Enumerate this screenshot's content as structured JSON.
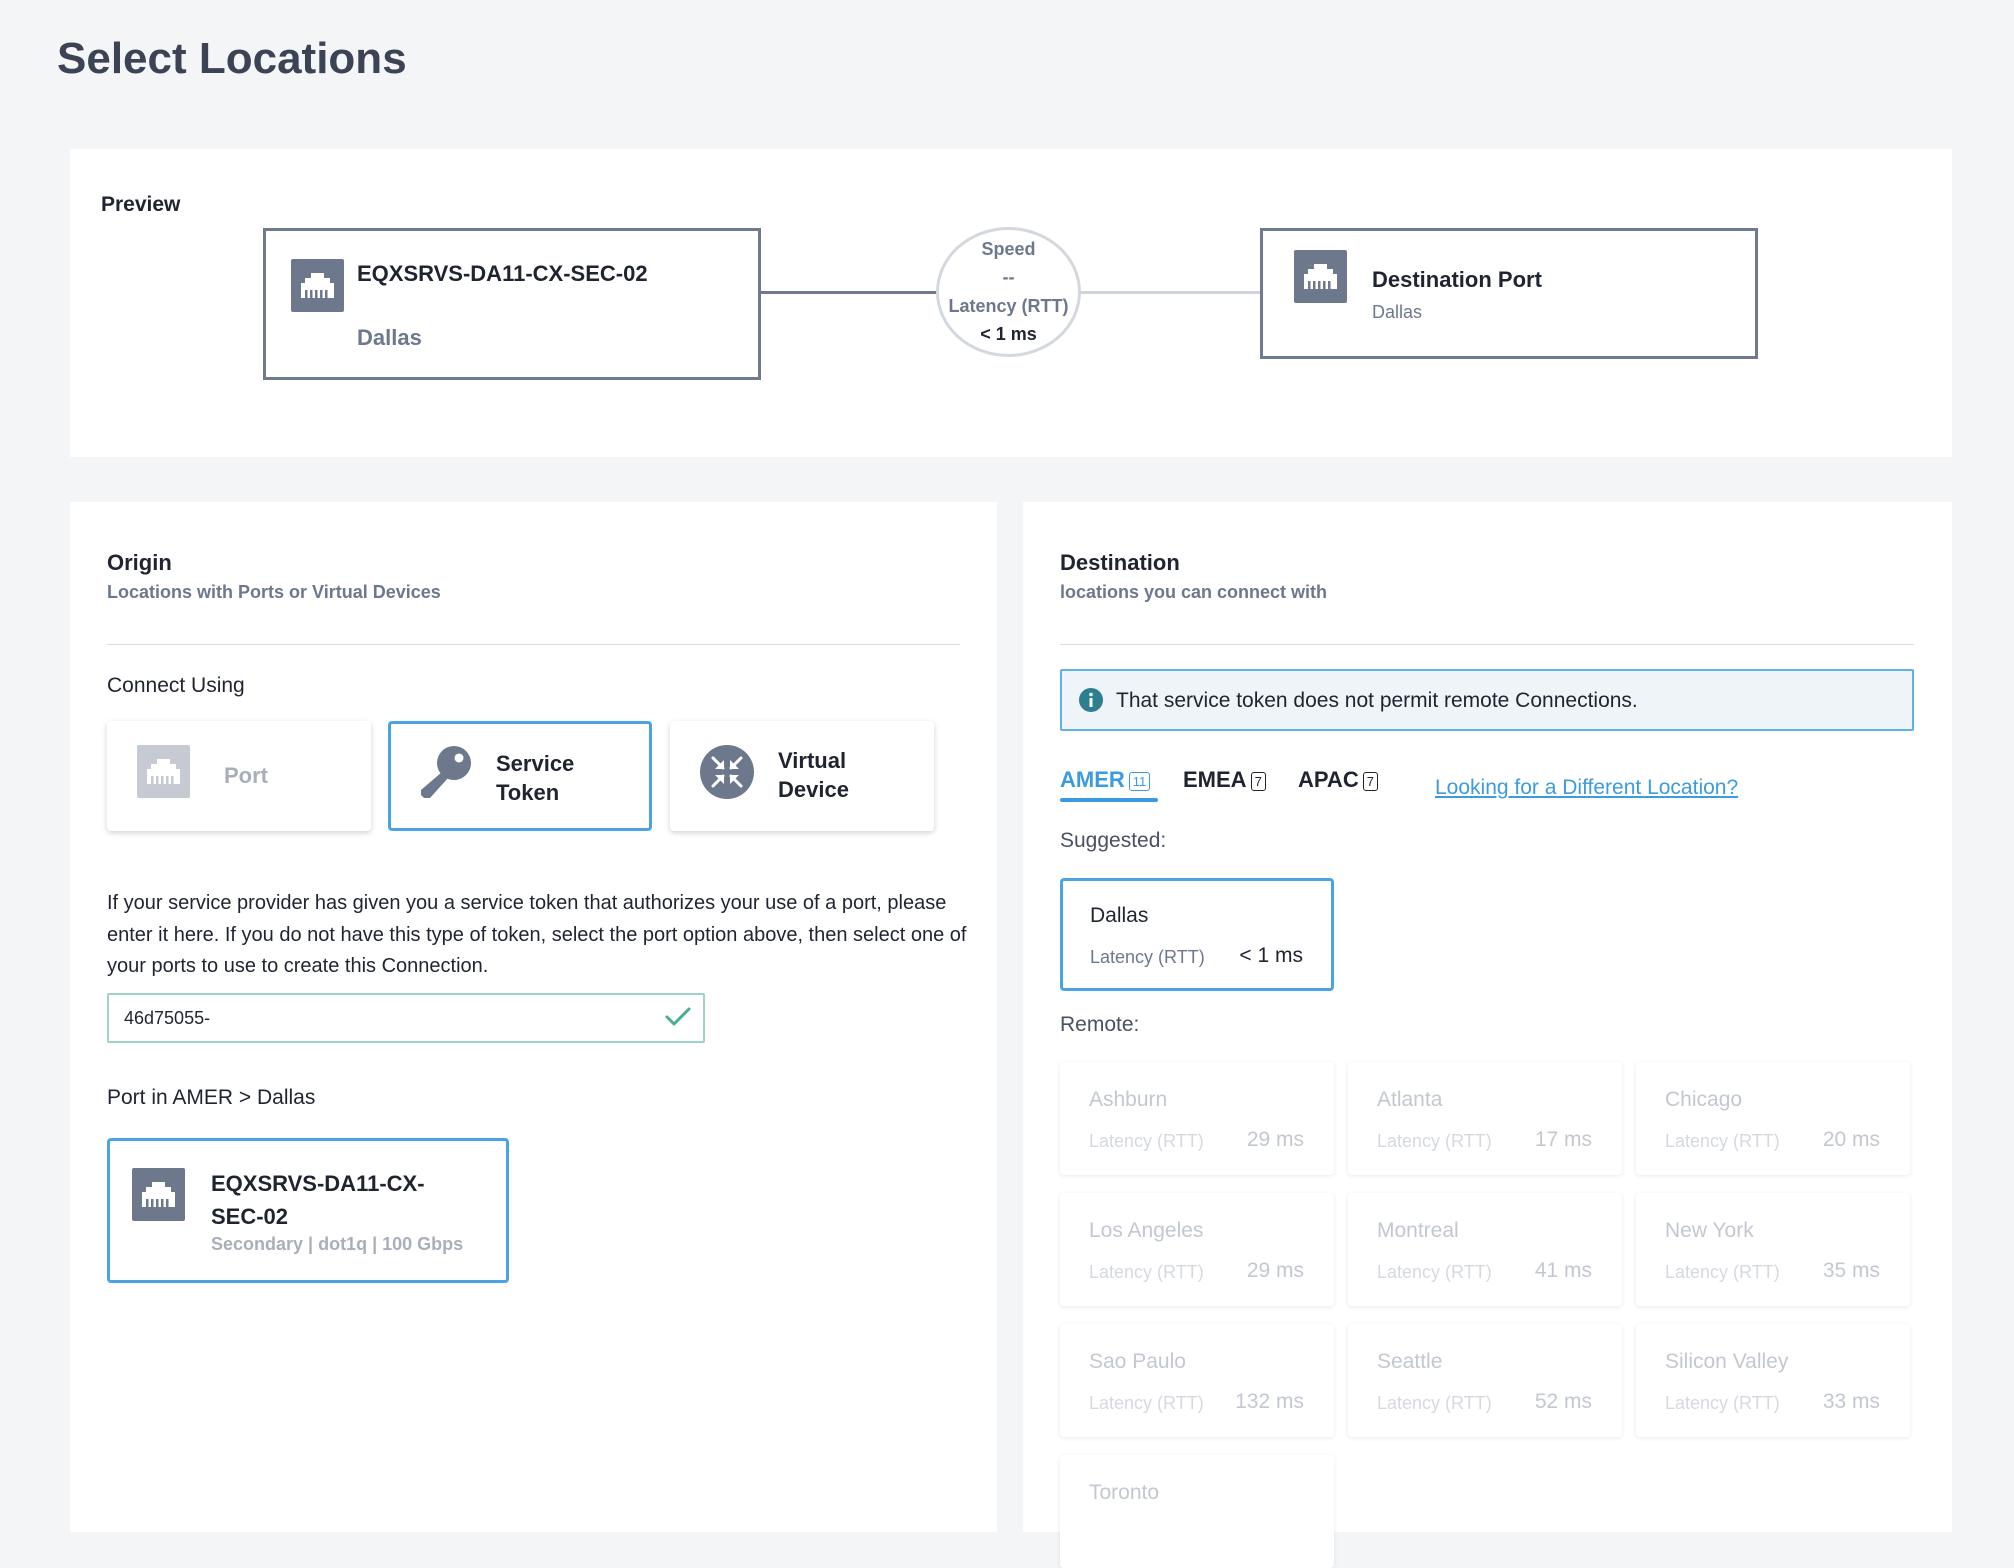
{
  "page": {
    "title": "Select Locations"
  },
  "preview": {
    "label": "Preview",
    "origin": {
      "name": "EQXSRVS-DA11-CX-SEC-02",
      "location": "Dallas",
      "icon": "ethernet-port-icon"
    },
    "connection": {
      "speed_label": "Speed",
      "speed_value": "--",
      "latency_label": "Latency (RTT)",
      "latency_value": "< 1 ms"
    },
    "destination": {
      "name": "Destination Port",
      "location": "Dallas",
      "icon": "ethernet-port-icon"
    }
  },
  "origin": {
    "title": "Origin",
    "subtitle": "Locations with Ports or Virtual Devices",
    "connect_using_label": "Connect Using",
    "options": [
      {
        "label": "Port",
        "icon": "ethernet-port-icon",
        "state": "disabled"
      },
      {
        "label_line1": "Service",
        "label_line2": "Token",
        "icon": "key-icon",
        "state": "selected"
      },
      {
        "label_line1": "Virtual",
        "label_line2": "Device",
        "icon": "virtual-device-icon",
        "state": "default"
      }
    ],
    "description": "If your service provider has given you a service token that authorizes your use of a port, please enter it here. If you do not have this type of token, select the port option above, then select one of your ports to use to create this Connection.",
    "token_input": {
      "value": "46d75055-"
    },
    "port_location_label": "Port in AMER > Dallas",
    "port_card": {
      "name": "EQXSRVS-DA11-CX-SEC-02",
      "meta": "Secondary | dot1q | 100 Gbps"
    }
  },
  "destination": {
    "title": "Destination",
    "subtitle": "locations you can connect with",
    "alert": "That service token does not permit remote Connections.",
    "tabs": [
      {
        "label": "AMER",
        "count": "11",
        "active": true
      },
      {
        "label": "EMEA",
        "count": "7",
        "active": false
      },
      {
        "label": "APAC",
        "count": "7",
        "active": false
      }
    ],
    "different_location_link": "Looking for a Different Location?",
    "suggested_label": "Suggested:",
    "suggested": {
      "name": "Dallas",
      "latency_label": "Latency (RTT)",
      "latency": "< 1 ms"
    },
    "remote_label": "Remote:",
    "remote": [
      {
        "name": "Ashburn",
        "latency_label": "Latency (RTT)",
        "latency": "29 ms"
      },
      {
        "name": "Atlanta",
        "latency_label": "Latency (RTT)",
        "latency": "17 ms"
      },
      {
        "name": "Chicago",
        "latency_label": "Latency (RTT)",
        "latency": "20 ms"
      },
      {
        "name": "Los Angeles",
        "latency_label": "Latency (RTT)",
        "latency": "29 ms"
      },
      {
        "name": "Montreal",
        "latency_label": "Latency (RTT)",
        "latency": "41 ms"
      },
      {
        "name": "New York",
        "latency_label": "Latency (RTT)",
        "latency": "35 ms"
      },
      {
        "name": "Sao Paulo",
        "latency_label": "Latency (RTT)",
        "latency": "132 ms"
      },
      {
        "name": "Seattle",
        "latency_label": "Latency (RTT)",
        "latency": "52 ms"
      },
      {
        "name": "Silicon Valley",
        "latency_label": "Latency (RTT)",
        "latency": "33 ms"
      },
      {
        "name": "Toronto"
      }
    ]
  },
  "colors": {
    "accent": "#3c9be0",
    "selected_border": "#4ba3e3",
    "slate": "#6d788d",
    "success": "#4cae8c"
  }
}
